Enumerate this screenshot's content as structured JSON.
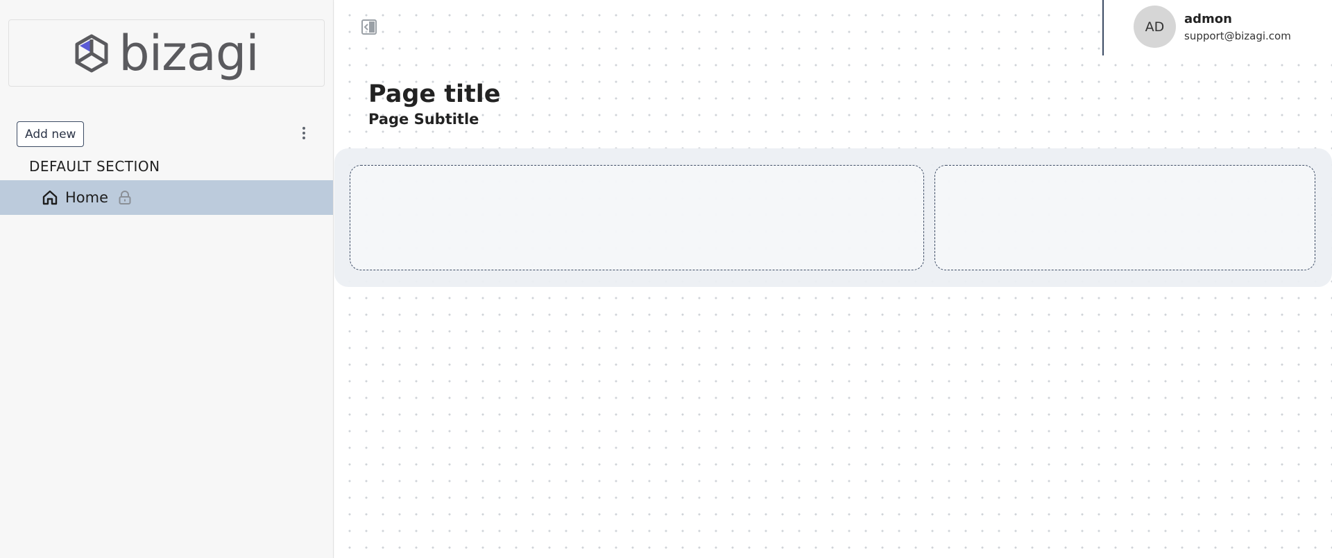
{
  "sidebar": {
    "logo_text": "bizagi",
    "add_new_label": "Add new",
    "more_icon": "more-vertical-icon",
    "section_title": "DEFAULT SECTION",
    "items": [
      {
        "label": "Home",
        "icon": "home-icon",
        "locked": true
      }
    ]
  },
  "header": {
    "collapse_icon": "collapse-sidebar-icon",
    "user": {
      "initials": "AD",
      "name": "admon",
      "email": "support@bizagi.com"
    }
  },
  "main": {
    "title": "Page title",
    "subtitle": "Page Subtitle"
  },
  "colors": {
    "accent": "#3b4a63",
    "nav_selected": "#bccbdc",
    "logo_accent": "#5b5bd6",
    "logo_gray": "#5a5a5e"
  }
}
